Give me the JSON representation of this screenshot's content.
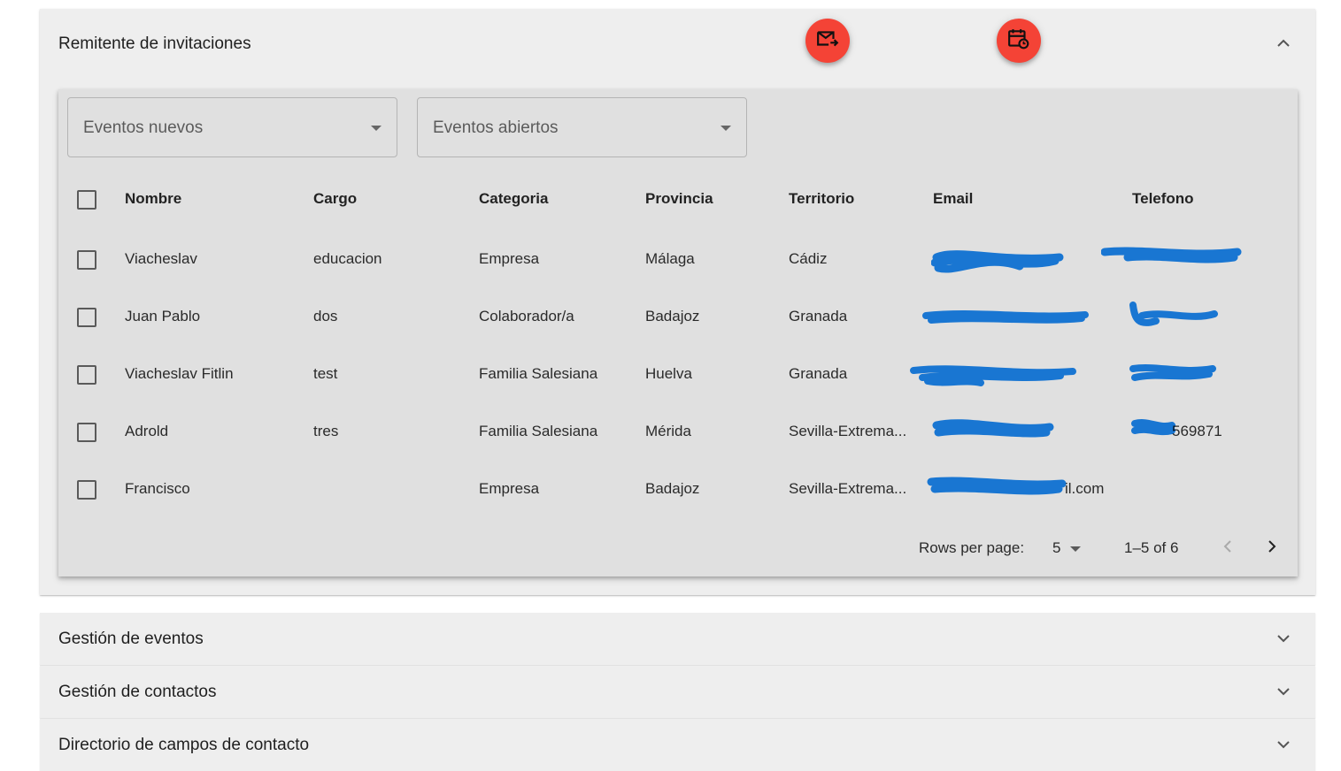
{
  "panels": {
    "invitations": {
      "title": "Remitente de invitaciones"
    },
    "events": {
      "title": "Gestión de eventos"
    },
    "contacts": {
      "title": "Gestión de contactos"
    },
    "fields": {
      "title": "Directorio de campos de contacto"
    }
  },
  "actions": [
    {
      "icon": "forward-email-icon"
    },
    {
      "icon": "calendar-sync-icon"
    }
  ],
  "filters": {
    "new_events": "Eventos nuevos",
    "open_events": "Eventos abiertos"
  },
  "table": {
    "columns": [
      "Nombre",
      "Cargo",
      "Categoria",
      "Provincia",
      "Territorio",
      "Email",
      "Telefono"
    ],
    "rows": [
      {
        "nombre": "Viacheslav",
        "cargo": "educacion",
        "categoria": "Empresa",
        "provincia": "Málaga",
        "territorio": "Cádiz",
        "email": "",
        "telefono": ""
      },
      {
        "nombre": "Juan Pablo",
        "cargo": "dos",
        "categoria": "Colaborador/a",
        "provincia": "Badajoz",
        "territorio": "Granada",
        "email": "",
        "telefono": ""
      },
      {
        "nombre": "Viacheslav Fitlin",
        "cargo": "test",
        "categoria": "Familia Salesiana",
        "provincia": "Huelva",
        "territorio": "Granada",
        "email": "",
        "telefono": ""
      },
      {
        "nombre": "Adrold",
        "cargo": "tres",
        "categoria": "Familia Salesiana",
        "provincia": "Mérida",
        "territorio": "Sevilla-Extrema...",
        "email": "",
        "telefono": "569871"
      },
      {
        "nombre": "Francisco",
        "cargo": "",
        "categoria": "Empresa",
        "provincia": "Badajoz",
        "territorio": "Sevilla-Extrema...",
        "email": "il.com",
        "telefono": ""
      }
    ]
  },
  "pagination": {
    "rows_per_page_label": "Rows per page:",
    "rows_per_page_value": "5",
    "range": "1–5 of 6"
  },
  "colors": {
    "fab": "#f44336",
    "redaction": "#1976d2",
    "panel_bg": "#eeeeee",
    "card_bg": "#e0e0e0"
  }
}
